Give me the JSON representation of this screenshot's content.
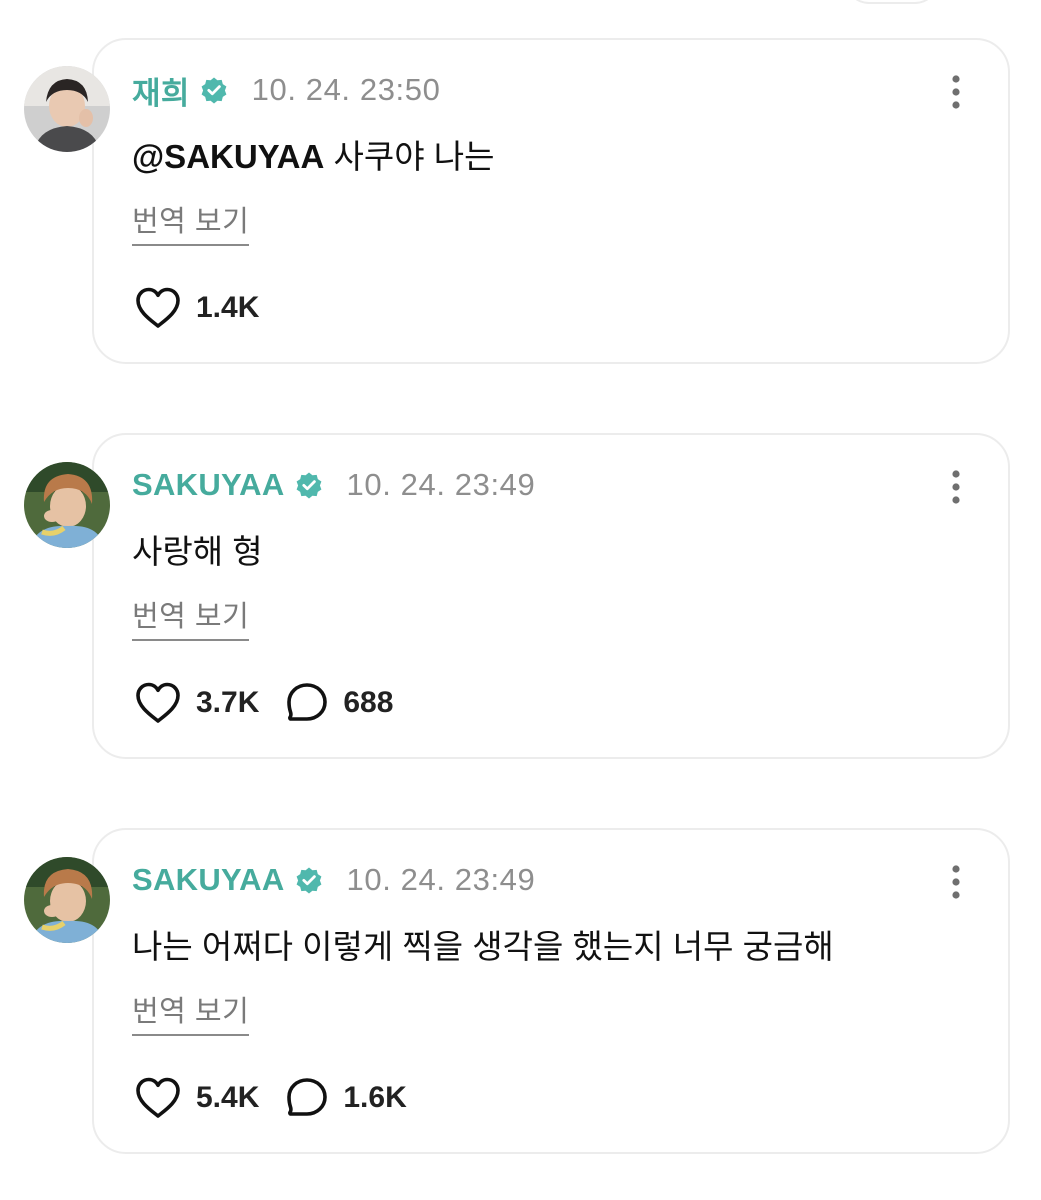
{
  "theme": {
    "accent": "#46ab9d",
    "verified": "#50b8ad",
    "muted": "#8e8e8e"
  },
  "posts": [
    {
      "username": "재희",
      "time": "10. 24. 23:50",
      "mention": "@SAKUYAA",
      "text": " 사쿠야 나는",
      "translate_label": "번역 보기",
      "likes": "1.4K",
      "replies": null,
      "avatar": "avatar-jaehee"
    },
    {
      "username": "SAKUYAA",
      "time": "10. 24. 23:49",
      "mention": "",
      "text": "사랑해 형",
      "translate_label": "번역 보기",
      "likes": "3.7K",
      "replies": "688",
      "avatar": "avatar-sakuyaa"
    },
    {
      "username": "SAKUYAA",
      "time": "10. 24. 23:49",
      "mention": "",
      "text": "나는 어쩌다 이렇게 찍을 생각을 했는지 너무 궁금해",
      "translate_label": "번역 보기",
      "likes": "5.4K",
      "replies": "1.6K",
      "avatar": "avatar-sakuyaa"
    }
  ],
  "icons": {
    "verified": "verified-badge-icon",
    "more": "more-vertical-icon",
    "like": "heart-icon",
    "reply": "reply-bubble-icon"
  }
}
